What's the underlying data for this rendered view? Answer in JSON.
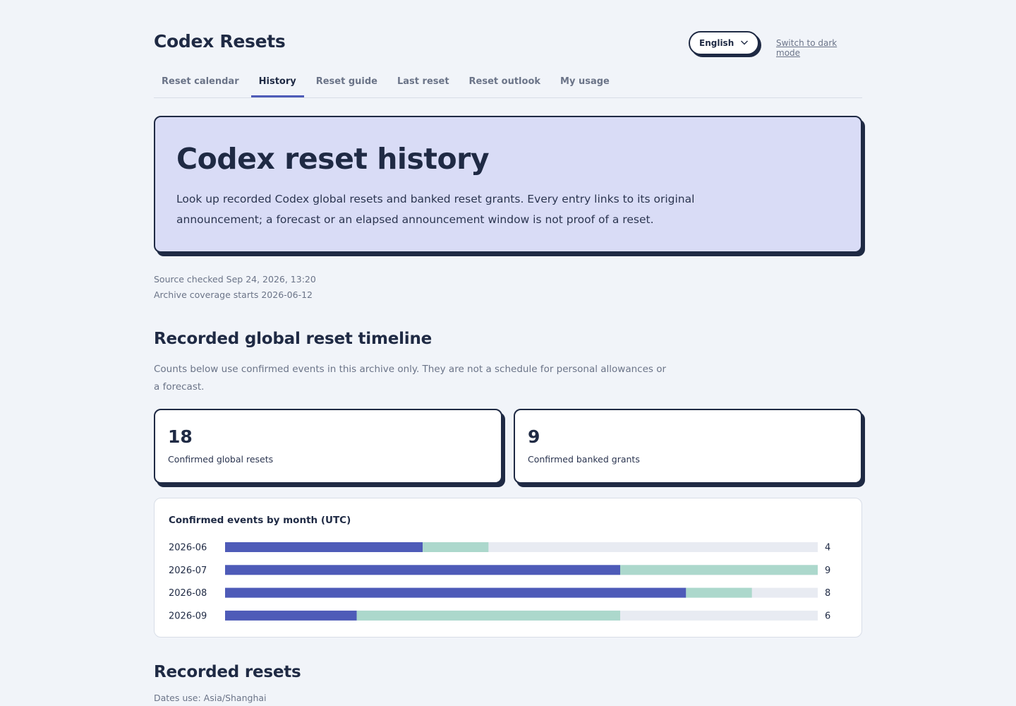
{
  "header": {
    "brand": "Codex Resets",
    "language": "English",
    "dark_mode_link": "Switch to dark mode"
  },
  "tabs": [
    {
      "label": "Reset calendar",
      "active": false
    },
    {
      "label": "History",
      "active": true
    },
    {
      "label": "Reset guide",
      "active": false
    },
    {
      "label": "Last reset",
      "active": false
    },
    {
      "label": "Reset outlook",
      "active": false
    },
    {
      "label": "My usage",
      "active": false
    }
  ],
  "hero": {
    "title": "Codex reset history",
    "description": "Look up recorded Codex global resets and banked reset grants. Every entry links to its original announcement; a forecast or an elapsed announcement window is not proof of a reset."
  },
  "meta": {
    "source_checked": "Source checked Sep 24, 2026, 13:20",
    "archive_coverage": "Archive coverage starts 2026-06-12"
  },
  "timeline": {
    "heading": "Recorded global reset timeline",
    "description": "Counts below use confirmed events in this archive only. They are not a schedule for personal allowances or a forecast."
  },
  "stats": [
    {
      "value": "18",
      "label": "Confirmed global resets"
    },
    {
      "value": "9",
      "label": "Confirmed banked grants"
    }
  ],
  "chart_data": {
    "type": "bar",
    "orientation": "horizontal",
    "stacked": true,
    "title": "Confirmed events by month (UTC)",
    "categories": [
      "2026-06",
      "2026-07",
      "2026-08",
      "2026-09"
    ],
    "series": [
      {
        "values": [
          3,
          6,
          7,
          2
        ],
        "color": "#4e5bb8"
      },
      {
        "values": [
          1,
          3,
          1,
          4
        ],
        "color": "#acd8cc"
      }
    ],
    "totals": [
      4,
      9,
      8,
      6
    ],
    "xlim": [
      0,
      9
    ],
    "track_color": "#e8ebf2"
  },
  "resets": {
    "heading": "Recorded resets",
    "timezone_note": "Dates use: Asia/Shanghai"
  }
}
